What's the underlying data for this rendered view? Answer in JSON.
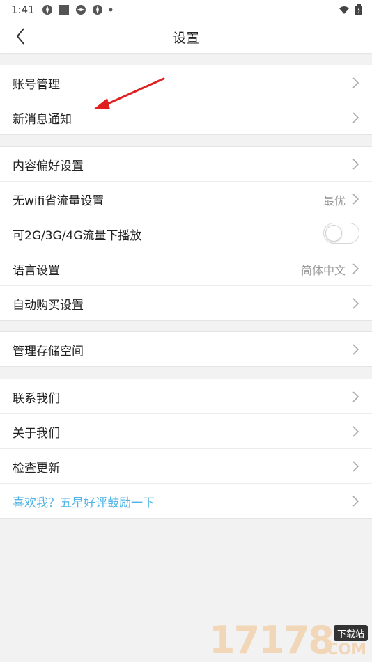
{
  "status": {
    "time": "1:41"
  },
  "header": {
    "title": "设置"
  },
  "groups": [
    {
      "items": [
        {
          "label": "账号管理"
        },
        {
          "label": "新消息通知"
        }
      ]
    },
    {
      "items": [
        {
          "label": "内容偏好设置"
        },
        {
          "label": "无wifi省流量设置",
          "value": "最优"
        },
        {
          "label": "可2G/3G/4G流量下播放",
          "toggle": false
        },
        {
          "label": "语言设置",
          "value": "简体中文"
        },
        {
          "label": "自动购买设置"
        }
      ]
    },
    {
      "items": [
        {
          "label": "管理存储空间"
        }
      ]
    },
    {
      "items": [
        {
          "label": "联系我们"
        },
        {
          "label": "关于我们"
        },
        {
          "label": "检查更新"
        },
        {
          "label": "喜欢我？五星好评鼓励一下"
        }
      ]
    }
  ],
  "watermark": {
    "digits": "17178",
    "badge": "下载站",
    "suffix": ".COM"
  },
  "colors": {
    "accent": "#4fb3e6",
    "arrow": "#e02020"
  }
}
